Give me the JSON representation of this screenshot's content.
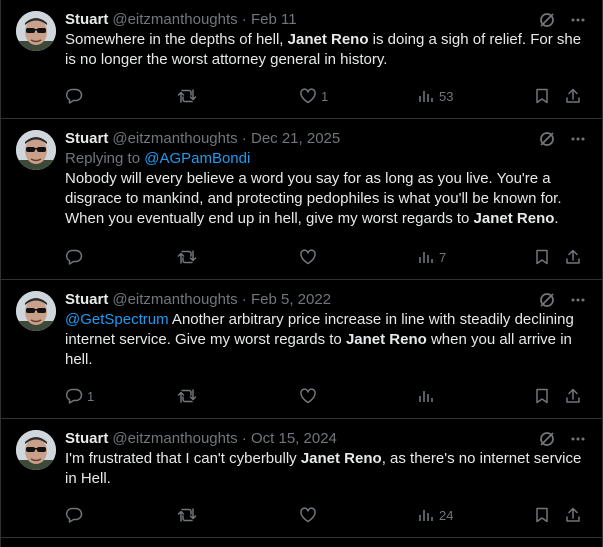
{
  "colors": {
    "background": "#000000",
    "text": "#e7e9ea",
    "muted": "#71767b",
    "link": "#1d9bf0",
    "divider": "#2f3336"
  },
  "tweets": [
    {
      "name": "Stuart",
      "handle": "@eitzmanthoughts",
      "date": "Feb 11",
      "reply_to": null,
      "text_parts": [
        {
          "t": "Somewhere in the depths of hell, ",
          "style": "plain"
        },
        {
          "t": "Janet Reno",
          "style": "bold"
        },
        {
          "t": " is doing a sigh of relief.  For she is no longer the worst attorney general in history.",
          "style": "plain"
        }
      ],
      "counts": {
        "replies": "",
        "retweets": "",
        "likes": "1",
        "views": "53"
      }
    },
    {
      "name": "Stuart",
      "handle": "@eitzmanthoughts",
      "date": "Dec 21, 2025",
      "reply_to": {
        "prefix": "Replying to ",
        "user": "@AGPamBondi"
      },
      "text_parts": [
        {
          "t": "Nobody will every believe a word you say for as long as you live.  You're a disgrace to mankind, and protecting pedophiles is what you'll be known for. When you eventually end up in hell, give my worst regards to ",
          "style": "plain"
        },
        {
          "t": "Janet Reno",
          "style": "bold"
        },
        {
          "t": ".",
          "style": "plain"
        }
      ],
      "counts": {
        "replies": "",
        "retweets": "",
        "likes": "",
        "views": "7"
      }
    },
    {
      "name": "Stuart",
      "handle": "@eitzmanthoughts",
      "date": "Feb 5, 2022",
      "reply_to": null,
      "text_parts": [
        {
          "t": "@GetSpectrum",
          "style": "link"
        },
        {
          "t": " Another arbitrary price increase in line with steadily declining internet service. Give my worst regards to ",
          "style": "plain"
        },
        {
          "t": "Janet Reno",
          "style": "bold"
        },
        {
          "t": " when you all arrive in hell.",
          "style": "plain"
        }
      ],
      "counts": {
        "replies": "1",
        "retweets": "",
        "likes": "",
        "views": ""
      }
    },
    {
      "name": "Stuart",
      "handle": "@eitzmanthoughts",
      "date": "Oct 15, 2024",
      "reply_to": null,
      "text_parts": [
        {
          "t": "I'm frustrated that I can't cyberbully ",
          "style": "plain"
        },
        {
          "t": "Janet Reno",
          "style": "bold"
        },
        {
          "t": ", as there's no internet service in Hell.",
          "style": "plain"
        }
      ],
      "counts": {
        "replies": "",
        "retweets": "",
        "likes": "",
        "views": "24"
      }
    }
  ],
  "icons": {
    "header": [
      "grok-icon",
      "more-icon"
    ],
    "actions": [
      "reply-icon",
      "retweet-icon",
      "like-icon",
      "views-icon",
      "bookmark-icon",
      "share-icon"
    ]
  }
}
